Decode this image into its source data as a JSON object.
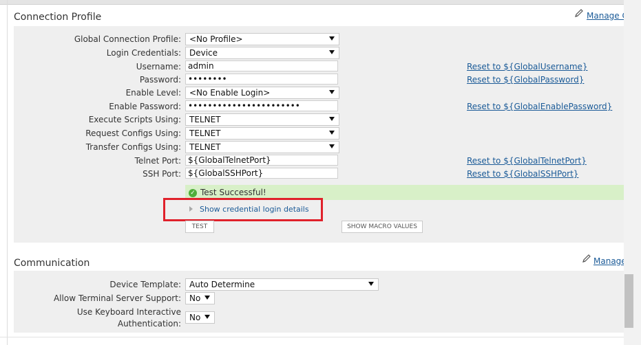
{
  "connection_profile": {
    "title": "Connection Profile",
    "manage_link": "Manage Co",
    "fields": {
      "global_profile": {
        "label": "Global Connection Profile:",
        "value": "<No Profile>"
      },
      "login_credentials": {
        "label": "Login Credentials:",
        "value": "Device"
      },
      "username": {
        "label": "Username:",
        "value": "admin",
        "reset": "Reset to ${GlobalUsername}"
      },
      "password": {
        "label": "Password:",
        "value": "••••••••",
        "reset": "Reset to ${GlobalPassword}"
      },
      "enable_level": {
        "label": "Enable Level:",
        "value": "<No Enable Login>"
      },
      "enable_password": {
        "label": "Enable Password:",
        "value": "•••••••••••••••••••••••",
        "reset": "Reset to ${GlobalEnablePassword}"
      },
      "execute_scripts": {
        "label": "Execute Scripts Using:",
        "value": "TELNET"
      },
      "request_configs": {
        "label": "Request Configs Using:",
        "value": "TELNET"
      },
      "transfer_configs": {
        "label": "Transfer Configs Using:",
        "value": "TELNET"
      },
      "telnet_port": {
        "label": "Telnet Port:",
        "value": "${GlobalTelnetPort}",
        "reset": "Reset to ${GlobalTelnetPort}"
      },
      "ssh_port": {
        "label": "SSH Port:",
        "value": "${GlobalSSHPort}",
        "reset": "Reset to ${GlobalSSHPort}"
      }
    },
    "test_status": "Test Successful!",
    "show_details_link": "Show credential login details",
    "test_button": "TEST",
    "macro_button": "SHOW MACRO VALUES"
  },
  "communication": {
    "title": "Communication",
    "manage_link": "Manage",
    "fields": {
      "device_template": {
        "label": "Device Template:",
        "value": "Auto Determine"
      },
      "terminal_server": {
        "label": "Allow Terminal Server Support:",
        "value": "No"
      },
      "keyboard_auth": {
        "label_line1": "Use Keyboard Interactive",
        "label_line2": "Authentication:",
        "value": "No"
      }
    }
  },
  "icons": {
    "manage": "pencil-icon",
    "success": "check-circle-icon",
    "expand": "triangle-right-icon"
  },
  "colors": {
    "link": "#1a5a97",
    "success_bg": "#d8f0c8",
    "highlight": "#e0212b",
    "panel_bg": "#efefef"
  }
}
